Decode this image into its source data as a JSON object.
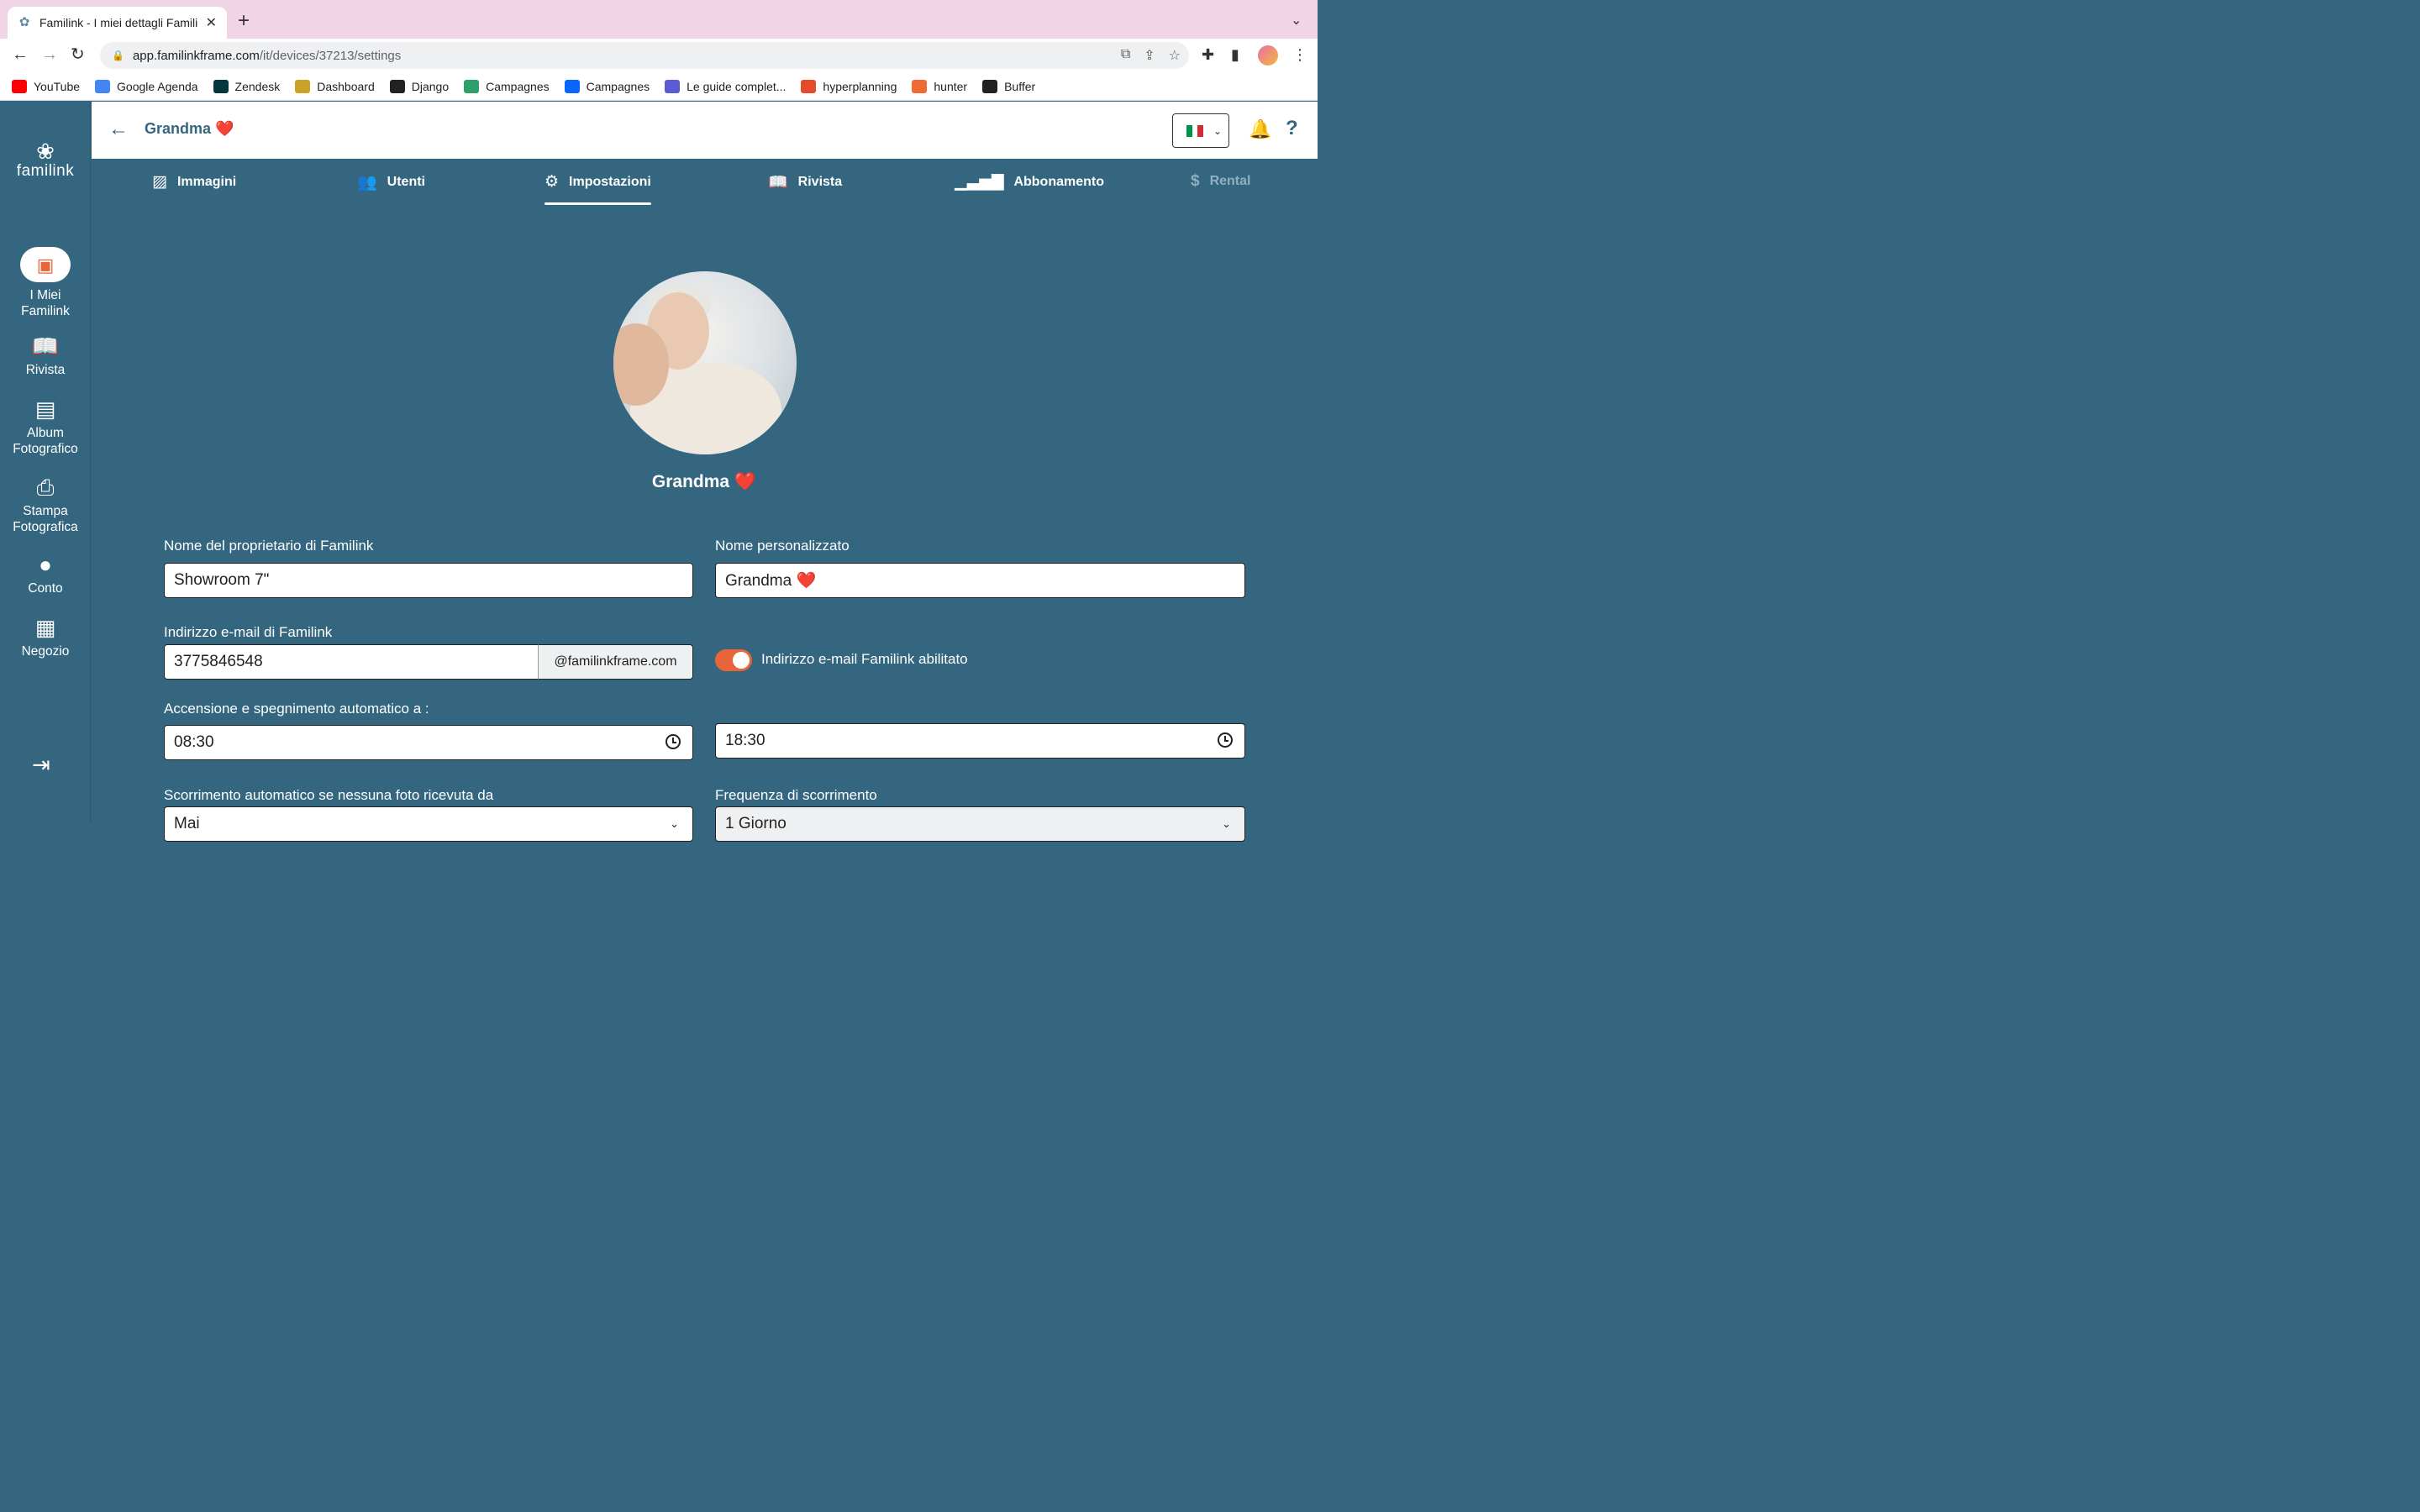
{
  "browser": {
    "tab_title": "Familink - I miei dettagli Famili",
    "url_host": "app.familinkframe.com",
    "url_path": "/it/devices/37213/settings",
    "bookmarks": [
      {
        "label": "YouTube",
        "color": "#ff0000"
      },
      {
        "label": "Google Agenda",
        "color": "#4285f4"
      },
      {
        "label": "Zendesk",
        "color": "#03363d"
      },
      {
        "label": "Dashboard",
        "color": "#c9a227"
      },
      {
        "label": "Django",
        "color": "#222222"
      },
      {
        "label": "Campagnes",
        "color": "#2e9e6b"
      },
      {
        "label": "Campagnes",
        "color": "#0866ff"
      },
      {
        "label": "Le guide complet...",
        "color": "#5b5bd6"
      },
      {
        "label": "hyperplanning",
        "color": "#e54b2b"
      },
      {
        "label": "hunter",
        "color": "#f06a35"
      },
      {
        "label": "Buffer",
        "color": "#222222"
      }
    ]
  },
  "sidebar": {
    "logo": "familink",
    "items": [
      {
        "label_1": "I Miei",
        "label_2": "Familink",
        "icon": "image-icon"
      },
      {
        "label_1": "Rivista",
        "label_2": "",
        "icon": "book-open-icon"
      },
      {
        "label_1": "Album",
        "label_2": "Fotografico",
        "icon": "album-icon"
      },
      {
        "label_1": "Stampa",
        "label_2": "Fotografica",
        "icon": "printer-icon"
      },
      {
        "label_1": "Conto",
        "label_2": "",
        "icon": "user-icon"
      },
      {
        "label_1": "Negozio",
        "label_2": "",
        "icon": "store-icon"
      }
    ]
  },
  "header": {
    "title": "Grandma ❤️"
  },
  "tabs": [
    {
      "label": "Immagini",
      "icon": "images-icon"
    },
    {
      "label": "Utenti",
      "icon": "users-icon"
    },
    {
      "label": "Impostazioni",
      "icon": "gear-icon"
    },
    {
      "label": "Rivista",
      "icon": "book-icon"
    },
    {
      "label": "Abbonamento",
      "icon": "signal-icon"
    },
    {
      "label": "Rental",
      "icon": "hand-dollar-icon"
    }
  ],
  "profile": {
    "name": "Grandma ❤️"
  },
  "form": {
    "owner_label": "Nome del proprietario di Familink",
    "owner_value": "Showroom 7\"",
    "custom_name_label": "Nome personalizzato",
    "custom_name_value": "Grandma ❤️",
    "email_label": "Indirizzo e-mail di Familink",
    "email_value": "3775846548",
    "email_domain": "@familinkframe.com",
    "email_enabled_label": "Indirizzo e-mail Familink abilitato",
    "auto_label": "Accensione e spegnimento automatico a :",
    "auto_on": "08:30",
    "auto_off": "18:30",
    "scroll_label": "Scorrimento automatico se nessuna foto ricevuta da",
    "scroll_value": "Mai",
    "freq_label": "Frequenza di scorrimento",
    "freq_value": "1 Giorno"
  },
  "colors": {
    "brand": "#35667f",
    "accent": "#e8653a"
  }
}
